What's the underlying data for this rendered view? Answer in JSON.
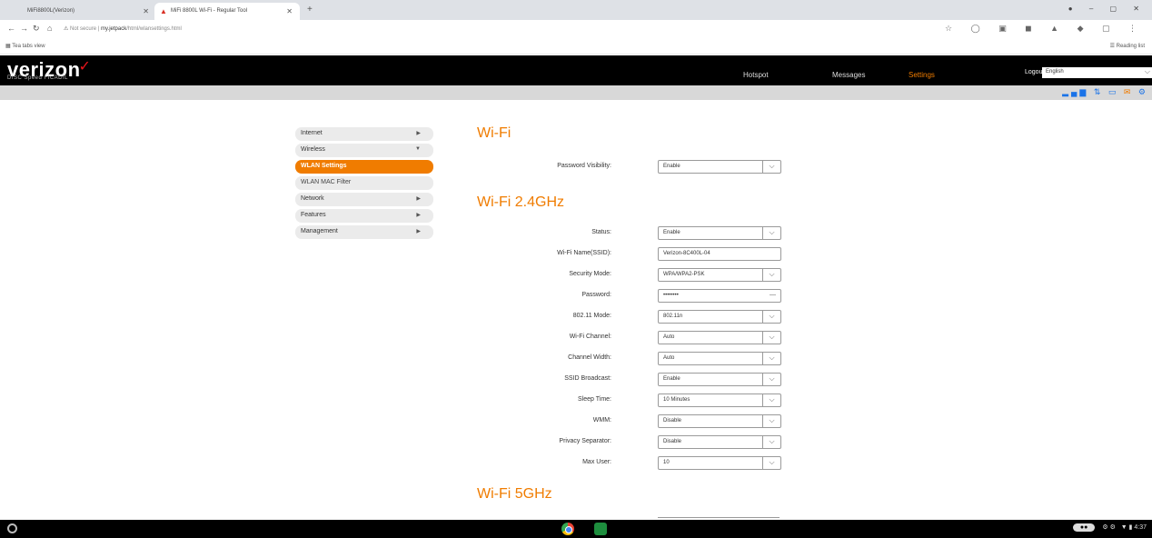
{
  "browser": {
    "tabs": [
      {
        "label": "MiFi8800L(Verizon)"
      },
      {
        "label": "MiFi 8800L Wi-Fi - Regular Tool"
      }
    ],
    "url_prefix": "Not secure",
    "url_host": "my.jetpack",
    "url_path": "/html/wlansettings.html",
    "bookmarks_apps": "Tea tabs view",
    "reading_list": "Reading list"
  },
  "header": {
    "brand": "verizon",
    "model": "DISC Speed FICADIL",
    "nav": [
      "Hotspot",
      "Messages",
      "Settings"
    ],
    "logout": "Logout",
    "language": "English"
  },
  "sidebar": {
    "items": [
      {
        "label": "Internet",
        "arrow": "▶"
      },
      {
        "label": "Wireless",
        "arrow": "▼"
      },
      {
        "label": "WLAN Settings",
        "arrow": ""
      },
      {
        "label": "WLAN MAC Filter",
        "arrow": ""
      },
      {
        "label": "Network",
        "arrow": "▶"
      },
      {
        "label": "Features",
        "arrow": "▶"
      },
      {
        "label": "Management",
        "arrow": "▶"
      }
    ]
  },
  "main": {
    "wifi_title": "Wi-Fi",
    "password_visibility": {
      "label": "Password Visibility:",
      "value": "Enable"
    },
    "wifi24_title": "Wi-Fi 2.4GHz",
    "fields": [
      {
        "label": "Status:",
        "value": "Enable"
      },
      {
        "label": "Wi-Fi Name(SSID):",
        "value": "Verizon-8C400L-04"
      },
      {
        "label": "Security Mode:",
        "value": "WPA/WPA2-PSK"
      },
      {
        "label": "Password:",
        "value": "••••••••"
      },
      {
        "label": "802.11 Mode:",
        "value": "802.11n"
      },
      {
        "label": "Wi-Fi Channel:",
        "value": "Auto"
      },
      {
        "label": "Channel Width:",
        "value": "Auto"
      },
      {
        "label": "SSID Broadcast:",
        "value": "Enable"
      },
      {
        "label": "Sleep Time:",
        "value": "10 Minutes"
      },
      {
        "label": "WMM:",
        "value": "Disable"
      },
      {
        "label": "Privacy Separator:",
        "value": "Disable"
      },
      {
        "label": "Max User:",
        "value": "10"
      }
    ],
    "wifi5_title": "Wi-Fi 5GHz"
  },
  "taskbar": {
    "time": "4:37"
  }
}
